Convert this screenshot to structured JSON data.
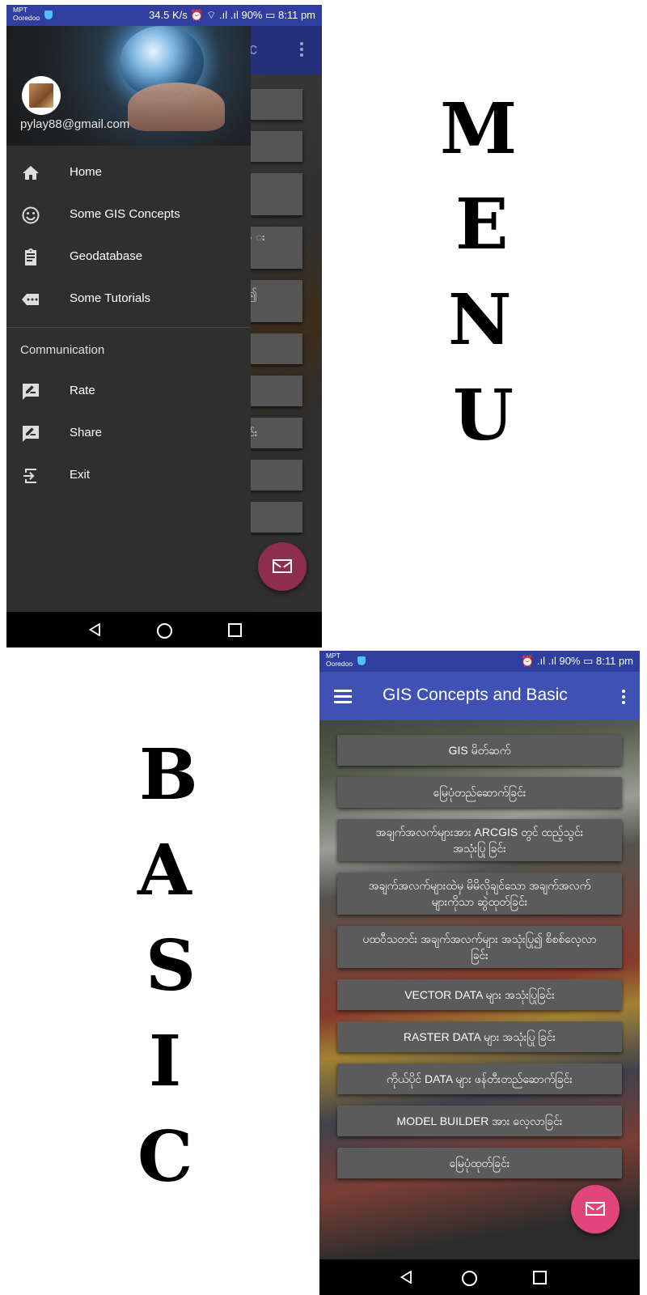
{
  "status": {
    "carrier_line1": "MPT",
    "carrier_line2": "Ooredoo",
    "menu_right": "34.5 K/s ⏰ ⌔ .ıl .ıl 90% ▭ 8:11 pm",
    "basic_right": "⏰ .ıl .ıl 90% ▭ 8:11 pm"
  },
  "drawer": {
    "email": "pylay88@gmail.com",
    "items": [
      {
        "label": "Home",
        "icon": "home-icon"
      },
      {
        "label": "Some GIS Concepts",
        "icon": "smiley-icon"
      },
      {
        "label": "Geodatabase",
        "icon": "clipboard-icon"
      },
      {
        "label": "Some Tutorials",
        "icon": "tag-icon"
      }
    ],
    "section": "Communication",
    "comm_items": [
      {
        "label": "Rate",
        "icon": "rate-icon"
      },
      {
        "label": "Share",
        "icon": "share-icon"
      },
      {
        "label": "Exit",
        "icon": "exit-icon"
      }
    ]
  },
  "menu_bg": {
    "title_fragment": "c",
    "snippets": [
      "",
      "",
      "ြ",
      "ာ း",
      "ပြု၍",
      "",
      "",
      "ခြင်း",
      "",
      ""
    ]
  },
  "letters": {
    "menu": [
      "M",
      "E",
      "N",
      "U"
    ],
    "basic": [
      "B",
      "A",
      "S",
      "I",
      "C"
    ]
  },
  "app": {
    "title": "GIS Concepts and Basic",
    "buttons": [
      "GIS မိတ်ဆက်",
      "မြေပုံတည်ဆောက်ခြင်း",
      "အချက်အလက်များအား ARCGIS တွင် ထည့်သွင်းအသုံးပြု ခြင်း",
      "အချက်အလက်များထဲမှ မိမိလိုချင်သော အချက်အလက်များကိုသာ ဆွဲထုတ်ခြင်း",
      "ပထဝီသတင်း အချက်အလက်များ အသုံးပြု၍ စိစစ်လေ့လာခြင်း",
      "VECTOR DATA များ အသုံးပြုခြင်း",
      "RASTER DATA များ အသုံးပြု ခြင်း",
      "ကိုယ်ပိုင် DATA များ ဖန်တီးတည်ဆောက်ခြင်း",
      "MODEL BUILDER အား လေ့လာခြင်း",
      "မြေပုံထုတ်ခြင်း"
    ]
  },
  "colors": {
    "status_bar": "#303f9f",
    "app_bar": "#3f51b5",
    "fab": "#e0457b",
    "drawer_bg": "#2f2f2f"
  }
}
